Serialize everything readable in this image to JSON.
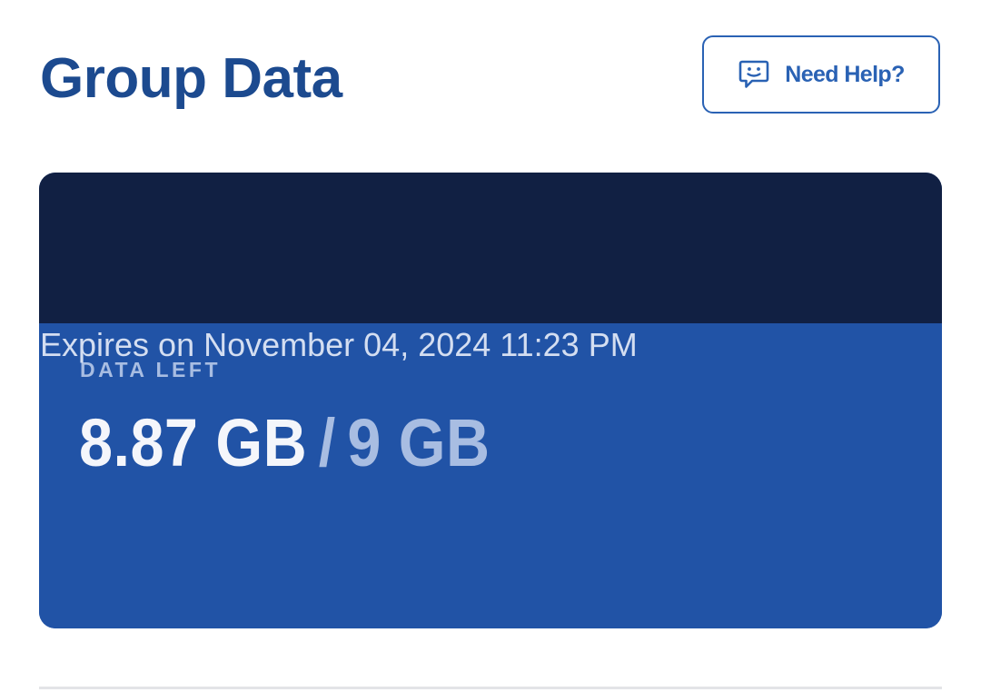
{
  "header": {
    "title": "Group Data",
    "help_button_label": "Need Help?",
    "help_icon": "chat-bubble-smile-icon",
    "accent_color": "#2a62b4",
    "title_color": "#1c4a8f"
  },
  "data_card": {
    "header_color": "#112043",
    "body_color": "#2153a6",
    "label": "DATA LEFT",
    "remaining": "8.87 GB",
    "separator": "/",
    "total": "9 GB",
    "expiry_text": "Expires on November 04, 2024 11:23 PM"
  }
}
